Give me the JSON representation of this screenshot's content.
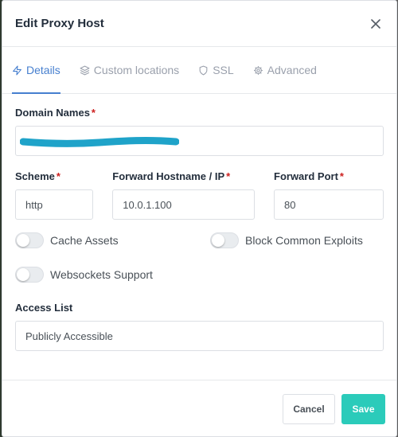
{
  "modal": {
    "title": "Edit Proxy Host"
  },
  "tabs": [
    {
      "label": "Details",
      "icon": "lightning-icon",
      "active": true
    },
    {
      "label": "Custom locations",
      "icon": "layers-icon",
      "active": false
    },
    {
      "label": "SSL",
      "icon": "shield-icon",
      "active": false
    },
    {
      "label": "Advanced",
      "icon": "gear-icon",
      "active": false
    }
  ],
  "form": {
    "domain_names": {
      "label": "Domain Names",
      "required_mark": "*",
      "value": ""
    },
    "scheme": {
      "label": "Scheme",
      "required_mark": "*",
      "value": "http"
    },
    "forward_host": {
      "label": "Forward Hostname / IP",
      "required_mark": "*",
      "value": "10.0.1.100"
    },
    "forward_port": {
      "label": "Forward Port",
      "required_mark": "*",
      "value": "80"
    },
    "toggles": {
      "cache_assets": {
        "label": "Cache Assets",
        "on": false
      },
      "block_exploits": {
        "label": "Block Common Exploits",
        "on": false
      },
      "websockets": {
        "label": "Websockets Support",
        "on": false
      }
    },
    "access_list": {
      "label": "Access List",
      "value": "Publicly Accessible"
    }
  },
  "footer": {
    "cancel_label": "Cancel",
    "save_label": "Save"
  },
  "colors": {
    "accent": "#467fcf",
    "save": "#2bcbba",
    "required": "#cd201f",
    "redaction": "#1fa3c9"
  }
}
